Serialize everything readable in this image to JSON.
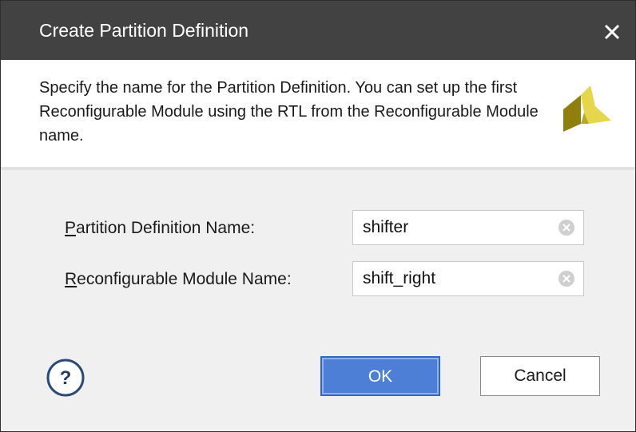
{
  "dialog": {
    "title": "Create Partition Definition",
    "close_icon": "close-icon",
    "description": "Specify the name for the Partition Definition. You can set up the first Reconfigurable Module using the RTL from the Reconfigurable Module name.",
    "logo_icon": "vivado-logo-icon"
  },
  "form": {
    "partition_label_mnemonic": "P",
    "partition_label_rest": "artition Definition Name:",
    "partition_value": "shifter",
    "module_label_mnemonic": "R",
    "module_label_rest": "econfigurable Module Name:",
    "module_value": "shift_right",
    "clear_icon": "clear-icon"
  },
  "buttons": {
    "help_icon": "help-icon",
    "ok_label": "OK",
    "cancel_label": "Cancel"
  },
  "colors": {
    "titlebar": "#424242",
    "primary_button": "#4d7fd6",
    "logo_dark": "#8f7f0c",
    "logo_light": "#e6d64a"
  }
}
